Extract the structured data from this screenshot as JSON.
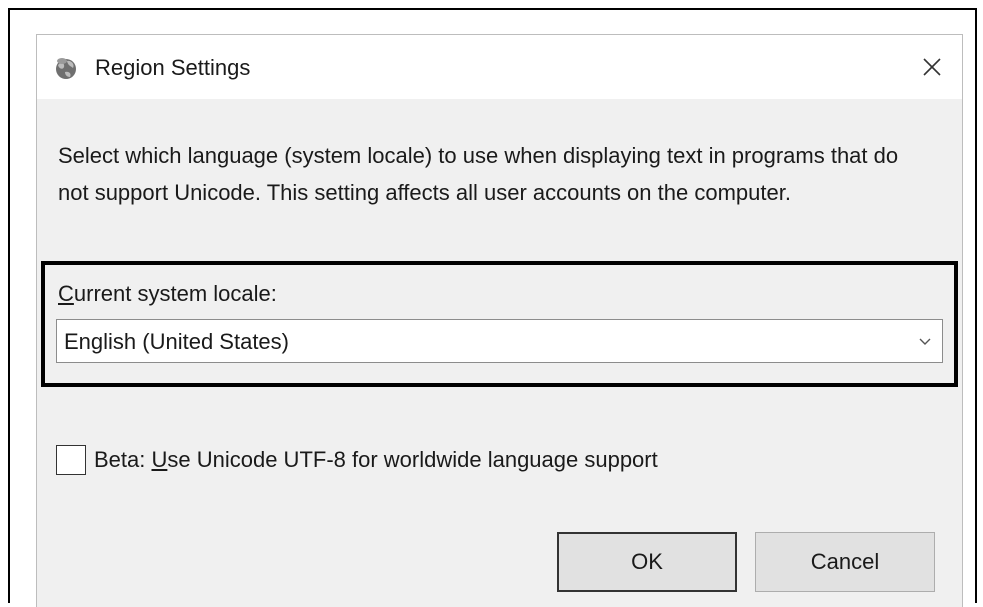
{
  "dialog": {
    "title": "Region Settings",
    "title_icon": "globe-icon",
    "close_icon": "close-icon"
  },
  "description": "Select which language (system locale) to use when displaying text in programs that do not support Unicode. This setting affects all user accounts on the computer.",
  "locale": {
    "label_accesskey": "C",
    "label_rest": "urrent system locale:",
    "selected_value": "English (United States)",
    "arrow_icon": "chevron-down-icon"
  },
  "beta": {
    "checked": false,
    "label_prefix": "Beta: ",
    "label_accesskey": "U",
    "label_rest": "se Unicode UTF-8 for worldwide language support"
  },
  "buttons": {
    "ok_label": "OK",
    "cancel_label": "Cancel"
  }
}
